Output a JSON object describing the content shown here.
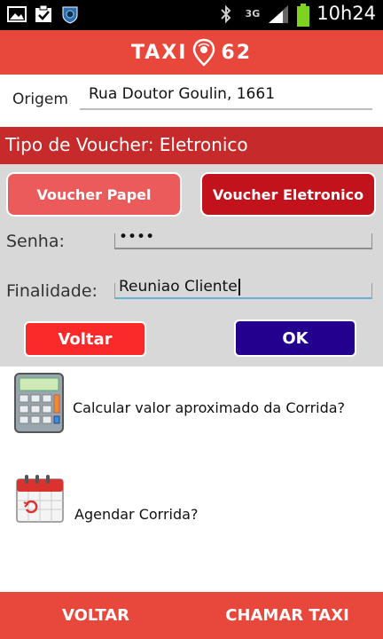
{
  "status_bar": {
    "time": "10h24",
    "network": "3G",
    "icons": [
      "image-icon",
      "checklist-icon",
      "shield-icon",
      "bluetooth-icon",
      "signal-icon",
      "battery-icon"
    ]
  },
  "header": {
    "logo_left": "TAXI",
    "logo_right": "62",
    "background": "#e8473b"
  },
  "origin": {
    "label": "Origem",
    "value": "Rua Doutor Goulin, 1661"
  },
  "voucher_type": {
    "title": "Tipo de Voucher: Eletronico"
  },
  "voucher_buttons": {
    "papel": "Voucher Papel",
    "eletronico": "Voucher Eletronico"
  },
  "form": {
    "senha_label": "Senha:",
    "senha_value": "••••",
    "finalidade_label": "Finalidade:",
    "finalidade_value": "Reuniao Cliente"
  },
  "actions": {
    "voltar": "Voltar",
    "ok": "OK"
  },
  "menu": {
    "calc": "Calcular valor aproximado da Corrida?",
    "agendar": "Agendar Corrida?"
  },
  "bottom_bar": {
    "voltar": "VOLTAR",
    "chamar": "CHAMAR TAXI"
  }
}
